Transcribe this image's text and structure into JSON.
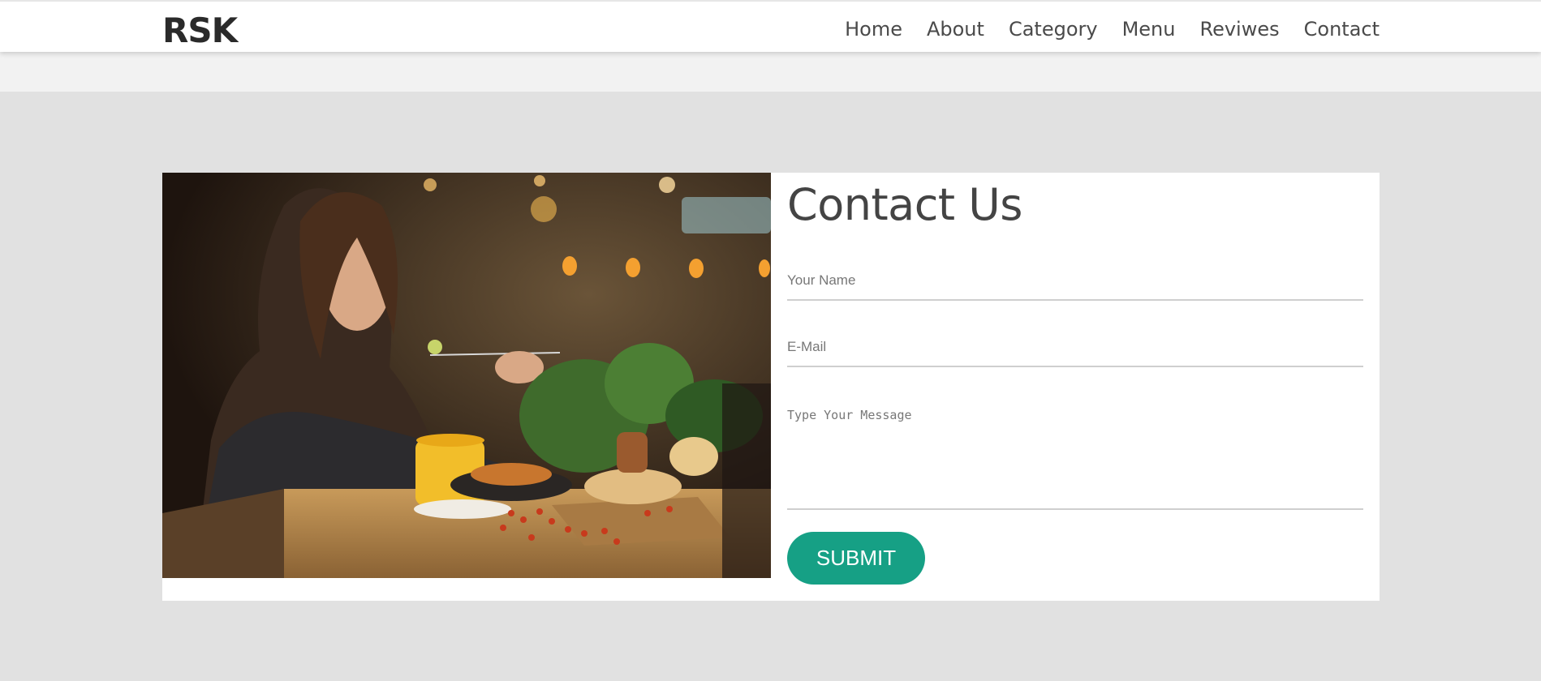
{
  "header": {
    "logo": "RSK",
    "nav": [
      {
        "label": "Home"
      },
      {
        "label": "About"
      },
      {
        "label": "Category"
      },
      {
        "label": "Menu"
      },
      {
        "label": "Reviwes"
      },
      {
        "label": "Contact"
      }
    ]
  },
  "contact": {
    "title": "Contact Us",
    "name_placeholder": "Your Name",
    "email_placeholder": "E-Mail",
    "message_placeholder": "Type Your Message",
    "submit_label": "SUBMIT"
  },
  "colors": {
    "accent": "#16a085",
    "page_background": "#e1e1e1",
    "navbar_background": "#ffffff"
  }
}
